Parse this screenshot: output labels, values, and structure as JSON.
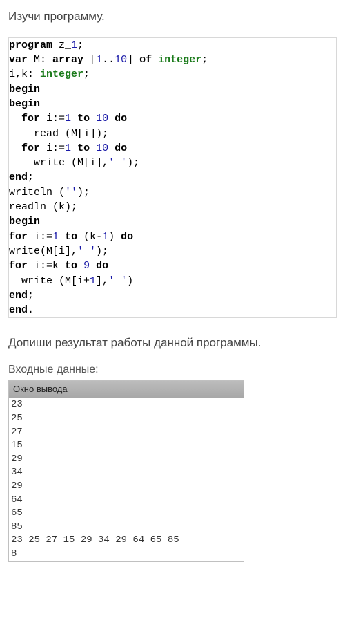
{
  "instruction": "Изучи программу.",
  "code": {
    "tokens": [
      [
        {
          "c": "kw",
          "t": "program"
        },
        {
          "c": "norm",
          "t": " z_"
        },
        {
          "c": "num",
          "t": "1"
        },
        {
          "c": "norm",
          "t": ";"
        }
      ],
      [
        {
          "c": "kw",
          "t": "var"
        },
        {
          "c": "norm",
          "t": " M: "
        },
        {
          "c": "kw",
          "t": "array"
        },
        {
          "c": "norm",
          "t": " ["
        },
        {
          "c": "num",
          "t": "1"
        },
        {
          "c": "norm",
          "t": ".."
        },
        {
          "c": "num",
          "t": "10"
        },
        {
          "c": "norm",
          "t": "] "
        },
        {
          "c": "kw",
          "t": "of"
        },
        {
          "c": "norm",
          "t": " "
        },
        {
          "c": "type",
          "t": "integer"
        },
        {
          "c": "norm",
          "t": ";"
        }
      ],
      [
        {
          "c": "norm",
          "t": "i,k: "
        },
        {
          "c": "type",
          "t": "integer"
        },
        {
          "c": "norm",
          "t": ";"
        }
      ],
      [
        {
          "c": "kw",
          "t": "begin"
        }
      ],
      [
        {
          "c": "kw",
          "t": "begin"
        }
      ],
      [
        {
          "c": "norm",
          "t": "  "
        },
        {
          "c": "kw",
          "t": "for"
        },
        {
          "c": "norm",
          "t": " i:="
        },
        {
          "c": "num",
          "t": "1"
        },
        {
          "c": "norm",
          "t": " "
        },
        {
          "c": "kw",
          "t": "to"
        },
        {
          "c": "norm",
          "t": " "
        },
        {
          "c": "num",
          "t": "10"
        },
        {
          "c": "norm",
          "t": " "
        },
        {
          "c": "kw",
          "t": "do"
        }
      ],
      [
        {
          "c": "norm",
          "t": "    read (M[i]);"
        }
      ],
      [
        {
          "c": "norm",
          "t": "  "
        },
        {
          "c": "kw",
          "t": "for"
        },
        {
          "c": "norm",
          "t": " i:="
        },
        {
          "c": "num",
          "t": "1"
        },
        {
          "c": "norm",
          "t": " "
        },
        {
          "c": "kw",
          "t": "to"
        },
        {
          "c": "norm",
          "t": " "
        },
        {
          "c": "num",
          "t": "10"
        },
        {
          "c": "norm",
          "t": " "
        },
        {
          "c": "kw",
          "t": "do"
        }
      ],
      [
        {
          "c": "norm",
          "t": "    write (M[i],"
        },
        {
          "c": "str",
          "t": "' '"
        },
        {
          "c": "norm",
          "t": ");"
        }
      ],
      [
        {
          "c": "kw",
          "t": "end"
        },
        {
          "c": "norm",
          "t": ";"
        }
      ],
      [
        {
          "c": "norm",
          "t": "writeln ("
        },
        {
          "c": "str",
          "t": "''"
        },
        {
          "c": "norm",
          "t": ");"
        }
      ],
      [
        {
          "c": "norm",
          "t": "readln (k);"
        }
      ],
      [
        {
          "c": "kw",
          "t": "begin"
        }
      ],
      [
        {
          "c": "kw",
          "t": "for"
        },
        {
          "c": "norm",
          "t": " i:="
        },
        {
          "c": "num",
          "t": "1"
        },
        {
          "c": "norm",
          "t": " "
        },
        {
          "c": "kw",
          "t": "to"
        },
        {
          "c": "norm",
          "t": " (k-"
        },
        {
          "c": "num",
          "t": "1"
        },
        {
          "c": "norm",
          "t": ") "
        },
        {
          "c": "kw",
          "t": "do"
        }
      ],
      [
        {
          "c": "norm",
          "t": "write(M[i],"
        },
        {
          "c": "str",
          "t": "' '"
        },
        {
          "c": "norm",
          "t": ");"
        }
      ],
      [
        {
          "c": "kw",
          "t": "for"
        },
        {
          "c": "norm",
          "t": " i:=k "
        },
        {
          "c": "kw",
          "t": "to"
        },
        {
          "c": "norm",
          "t": " "
        },
        {
          "c": "num",
          "t": "9"
        },
        {
          "c": "norm",
          "t": " "
        },
        {
          "c": "kw",
          "t": "do"
        }
      ],
      [
        {
          "c": "norm",
          "t": "  write (M[i+"
        },
        {
          "c": "num",
          "t": "1"
        },
        {
          "c": "norm",
          "t": "],"
        },
        {
          "c": "str",
          "t": "' '"
        },
        {
          "c": "norm",
          "t": ")"
        }
      ],
      [
        {
          "c": "kw",
          "t": "end"
        },
        {
          "c": "norm",
          "t": ";"
        }
      ],
      [
        {
          "c": "kw",
          "t": "end"
        },
        {
          "c": "norm",
          "t": "."
        }
      ]
    ]
  },
  "instruction2": "Допиши результат работы данной программы.",
  "input_label": "Входные данные:",
  "output_header": "Окно вывода",
  "output_lines": [
    "23",
    "25",
    "27",
    "15",
    "29",
    "34",
    "29",
    "64",
    "65",
    "85",
    "23 25 27 15 29 34 29 64 65 85",
    "8"
  ]
}
